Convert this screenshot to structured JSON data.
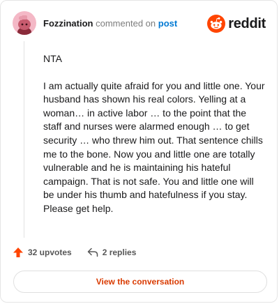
{
  "comment": {
    "username": "Fozzination",
    "action_text": "commented on",
    "link_text": "post",
    "paragraphs": [
      "NTA",
      "I am actually quite afraid for you and little one. Your husband has shown his real colors. Yelling at a woman… in active labor … to the point that the staff and nurses were alarmed enough … to get security … who threw him out. That sentence chills me to the bone. Now you and little one are totally vulnerable and he is maintaining his hateful campaign. That is not safe. You and little one will be under his thumb and hatefulness if you stay. Please get help."
    ]
  },
  "brand": {
    "wordmark": "reddit",
    "icon": "reddit-snoo-icon"
  },
  "actions": {
    "upvotes": "32 upvotes",
    "replies": "2 replies",
    "upvote_icon": "upvote-arrow-icon",
    "reply_icon": "reply-arrow-icon"
  },
  "cta": {
    "label": "View the conversation"
  },
  "colors": {
    "accent": "#d93a00",
    "brand_orange": "#ff4500",
    "link": "#0079d3",
    "avatar_bg": "#f4b8c6"
  }
}
